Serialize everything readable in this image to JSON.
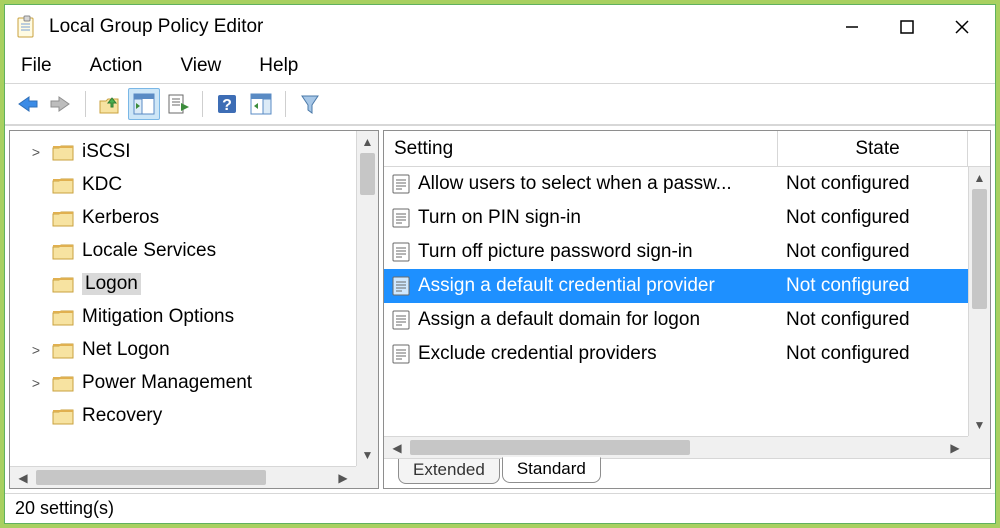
{
  "window": {
    "title": "Local Group Policy Editor"
  },
  "menu": {
    "file": "File",
    "action": "Action",
    "view": "View",
    "help": "Help"
  },
  "columns": {
    "setting": "Setting",
    "state": "State"
  },
  "tree": [
    {
      "label": "iSCSI",
      "expandable": true,
      "selected": false
    },
    {
      "label": "KDC",
      "expandable": false,
      "selected": false
    },
    {
      "label": "Kerberos",
      "expandable": false,
      "selected": false
    },
    {
      "label": "Locale Services",
      "expandable": false,
      "selected": false
    },
    {
      "label": "Logon",
      "expandable": false,
      "selected": true
    },
    {
      "label": "Mitigation Options",
      "expandable": false,
      "selected": false
    },
    {
      "label": "Net Logon",
      "expandable": true,
      "selected": false
    },
    {
      "label": "Power Management",
      "expandable": true,
      "selected": false
    },
    {
      "label": "Recovery",
      "expandable": false,
      "selected": false
    }
  ],
  "settings": [
    {
      "name": "Allow users to select when a passw...",
      "state": "Not configured",
      "selected": false
    },
    {
      "name": "Turn on PIN sign-in",
      "state": "Not configured",
      "selected": false
    },
    {
      "name": "Turn off picture password sign-in",
      "state": "Not configured",
      "selected": false
    },
    {
      "name": "Assign a default credential provider",
      "state": "Not configured",
      "selected": true
    },
    {
      "name": "Assign a default domain for logon",
      "state": "Not configured",
      "selected": false
    },
    {
      "name": "Exclude credential providers",
      "state": "Not configured",
      "selected": false
    }
  ],
  "tabs": {
    "extended": "Extended",
    "standard": "Standard"
  },
  "status": "20 setting(s)"
}
